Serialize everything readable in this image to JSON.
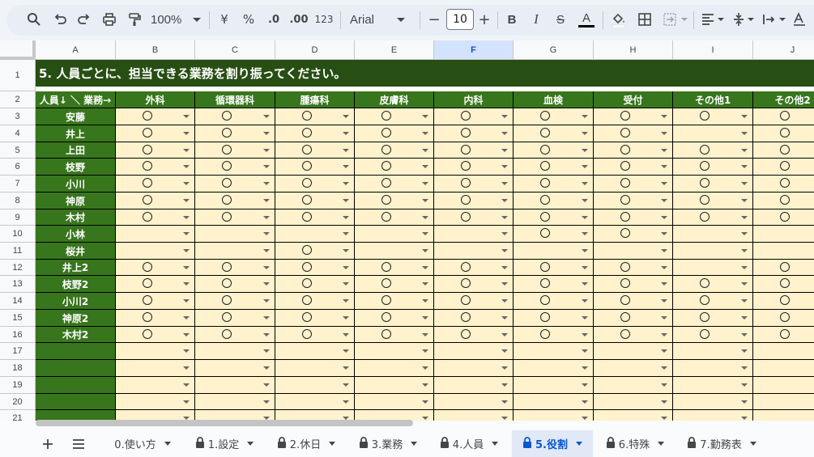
{
  "toolbar": {
    "zoom": "100%",
    "currency": "¥",
    "percent": "%",
    "dec_decrease": ".0",
    "dec_increase": ".00",
    "number_format": "123",
    "font": "Arial",
    "font_size": "10",
    "minus": "−",
    "plus": "+",
    "bold": "B",
    "italic": "I",
    "strike": "S",
    "text_color": "A"
  },
  "columns": [
    "A",
    "B",
    "C",
    "D",
    "E",
    "F",
    "G",
    "H",
    "I",
    "J"
  ],
  "selected_column": "F",
  "rows": [
    "1",
    "2",
    "3",
    "4",
    "5",
    "6",
    "7",
    "8",
    "9",
    "10",
    "11",
    "12",
    "13",
    "14",
    "15",
    "16",
    "17",
    "18",
    "19",
    "20",
    "21"
  ],
  "sheet": {
    "title": "5. 人員ごとに、担当できる業務を割り振ってください。",
    "header": [
      "人員↓ ＼ 業務→",
      "外科",
      "循環器科",
      "腫瘍科",
      "皮膚科",
      "内科",
      "血検",
      "受付",
      "その他1",
      "その他2"
    ],
    "people": [
      "安藤",
      "井上",
      "上田",
      "枝野",
      "小川",
      "神原",
      "木村",
      "小林",
      "桜井",
      "井上2",
      "枝野2",
      "小川2",
      "神原2",
      "木村2",
      "",
      "",
      "",
      "",
      ""
    ],
    "assignments": [
      [
        1,
        1,
        1,
        1,
        1,
        1,
        1,
        1,
        1
      ],
      [
        1,
        1,
        1,
        1,
        1,
        1,
        1,
        0,
        1
      ],
      [
        1,
        1,
        1,
        1,
        1,
        1,
        1,
        1,
        1
      ],
      [
        1,
        1,
        1,
        1,
        1,
        1,
        1,
        1,
        1
      ],
      [
        1,
        1,
        1,
        1,
        1,
        1,
        1,
        1,
        1
      ],
      [
        1,
        1,
        1,
        1,
        1,
        1,
        1,
        1,
        1
      ],
      [
        1,
        1,
        1,
        1,
        1,
        1,
        1,
        1,
        1
      ],
      [
        0,
        0,
        0,
        0,
        0,
        1,
        1,
        0,
        0
      ],
      [
        0,
        0,
        1,
        0,
        0,
        0,
        0,
        0,
        0
      ],
      [
        1,
        1,
        1,
        1,
        1,
        1,
        1,
        0,
        1
      ],
      [
        1,
        1,
        1,
        1,
        1,
        1,
        1,
        1,
        1
      ],
      [
        1,
        1,
        1,
        1,
        1,
        1,
        1,
        1,
        1
      ],
      [
        1,
        1,
        1,
        1,
        1,
        1,
        1,
        1,
        1
      ],
      [
        1,
        1,
        1,
        1,
        1,
        1,
        1,
        1,
        1
      ],
      [
        0,
        0,
        0,
        0,
        0,
        0,
        0,
        0,
        0
      ],
      [
        0,
        0,
        0,
        0,
        0,
        0,
        0,
        0,
        0
      ],
      [
        0,
        0,
        0,
        0,
        0,
        0,
        0,
        0,
        0
      ],
      [
        0,
        0,
        0,
        0,
        0,
        0,
        0,
        0,
        0
      ],
      [
        0,
        0,
        0,
        0,
        0,
        0,
        0,
        0,
        0
      ]
    ]
  },
  "tabs": [
    {
      "label": "0.使い方",
      "locked": false,
      "active": false
    },
    {
      "label": "1.設定",
      "locked": true,
      "active": false
    },
    {
      "label": "2.休日",
      "locked": true,
      "active": false
    },
    {
      "label": "3.業務",
      "locked": true,
      "active": false
    },
    {
      "label": "4.人員",
      "locked": true,
      "active": false
    },
    {
      "label": "5.役割",
      "locked": true,
      "active": true
    },
    {
      "label": "6.特殊",
      "locked": true,
      "active": false
    },
    {
      "label": "7.勤務表",
      "locked": true,
      "active": false
    }
  ],
  "colors": {
    "title_bg": "#274e13",
    "header_bg": "#38761d",
    "value_bg": "#fff2cc",
    "accent": "#0b57d0"
  }
}
